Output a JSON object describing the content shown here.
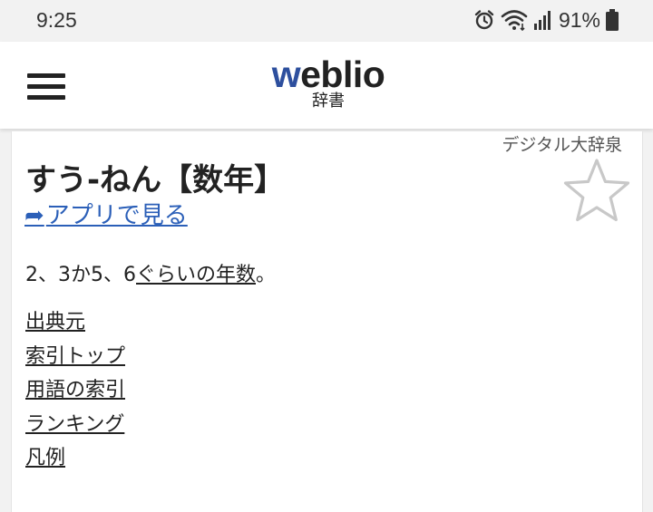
{
  "status_bar": {
    "time": "9:25",
    "battery": "91%",
    "icons": [
      "alarm-icon",
      "wifi-icon",
      "signal-icon",
      "battery-icon"
    ]
  },
  "header": {
    "logo_word_accent": "w",
    "logo_word_rest": "eblio",
    "logo_sub": "辞書",
    "brand_color": "#2d4f9e"
  },
  "entry": {
    "source": "デジタル大辞泉",
    "headword": "すう‐ねん【数年】",
    "app_link_arrow": "➦",
    "app_link_label": "アプリで見る",
    "definition_before": "2、3か5、6",
    "definition_link": "ぐらいの年数",
    "definition_after": "。",
    "link_color": "#2b5fb8"
  },
  "footer_links": [
    "出典元",
    "索引トップ",
    "用語の索引",
    "ランキング",
    "凡例"
  ]
}
